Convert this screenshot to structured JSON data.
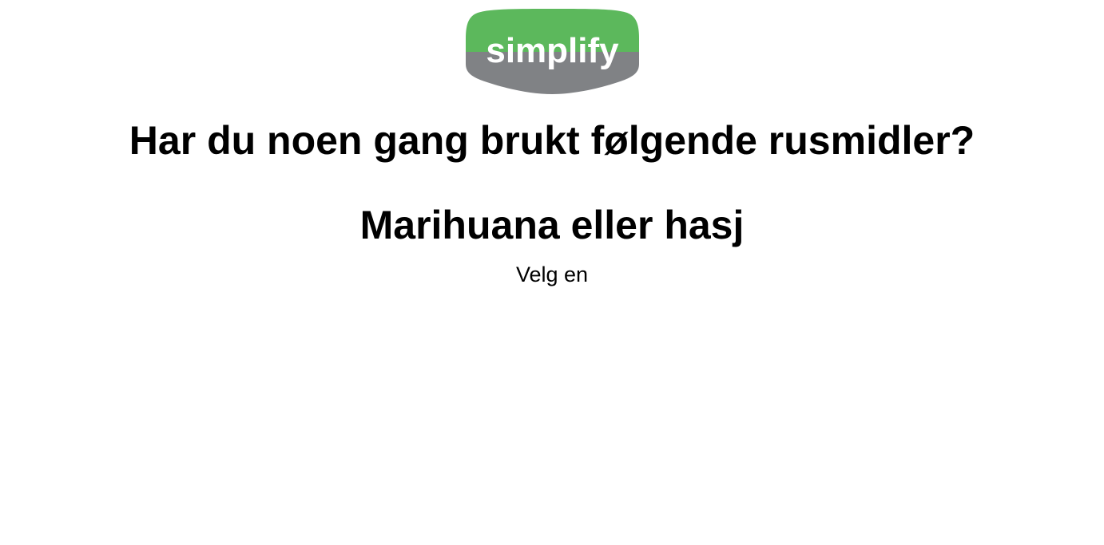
{
  "logo": {
    "text": "simplify",
    "colors": {
      "top": "#5cb85c",
      "bottom": "#808285",
      "text": "#ffffff"
    }
  },
  "question": {
    "text": "Har du noen gang brukt følgende rusmidler?"
  },
  "substance": {
    "text": "Marihuana eller hasj"
  },
  "hint": {
    "text": "Velg en"
  }
}
